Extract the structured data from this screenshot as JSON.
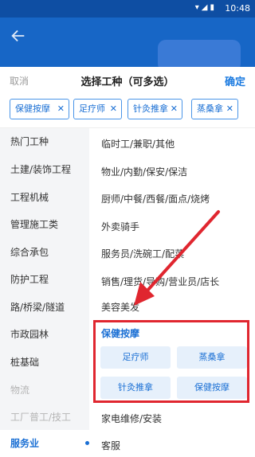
{
  "status": {
    "time": "10:48"
  },
  "sheet": {
    "cancel_label": "取消",
    "title": "选择工种（可多选）",
    "confirm_label": "确定"
  },
  "selected_chips": [
    {
      "label": "保健按摩"
    },
    {
      "label": "足疗师"
    },
    {
      "label": "针灸推拿"
    },
    {
      "label": "蒸桑拿"
    }
  ],
  "chip_close_glyph": "✕",
  "categories": [
    {
      "label": "热门工种"
    },
    {
      "label": "土建/装饰工程"
    },
    {
      "label": "工程机械"
    },
    {
      "label": "管理施工类"
    },
    {
      "label": "综合承包"
    },
    {
      "label": "防护工程"
    },
    {
      "label": "路/桥梁/隧道"
    },
    {
      "label": "市政园林"
    },
    {
      "label": "桩基础"
    },
    {
      "label": "物流"
    },
    {
      "label": "工厂普工/技工"
    },
    {
      "label": "服务业"
    }
  ],
  "subcategories": [
    {
      "label": "临时工/兼职/其他"
    },
    {
      "label": "物业/内勤/保安/保洁"
    },
    {
      "label": "厨师/中餐/西餐/面点/烧烤"
    },
    {
      "label": "外卖骑手"
    },
    {
      "label": "服务员/洗碗工/配菜"
    },
    {
      "label": "销售/理货/导购/营业员/店长"
    },
    {
      "label": "美容美发"
    }
  ],
  "massage_group": {
    "header": "保健按摩",
    "options": [
      {
        "label": "足疗师"
      },
      {
        "label": "蒸桑拿"
      },
      {
        "label": "针灸推拿"
      },
      {
        "label": "保健按摩"
      }
    ]
  },
  "more_items": [
    {
      "label": "家电维修/安装"
    },
    {
      "label": "客服"
    }
  ],
  "colors": {
    "accent": "#1a6fd4",
    "highlight": "#e0262f",
    "app_bar": "#1766c6"
  },
  "icons": {
    "back": "back-arrow-icon",
    "chip_close": "close-icon",
    "annotation_arrow": "red-arrow"
  }
}
